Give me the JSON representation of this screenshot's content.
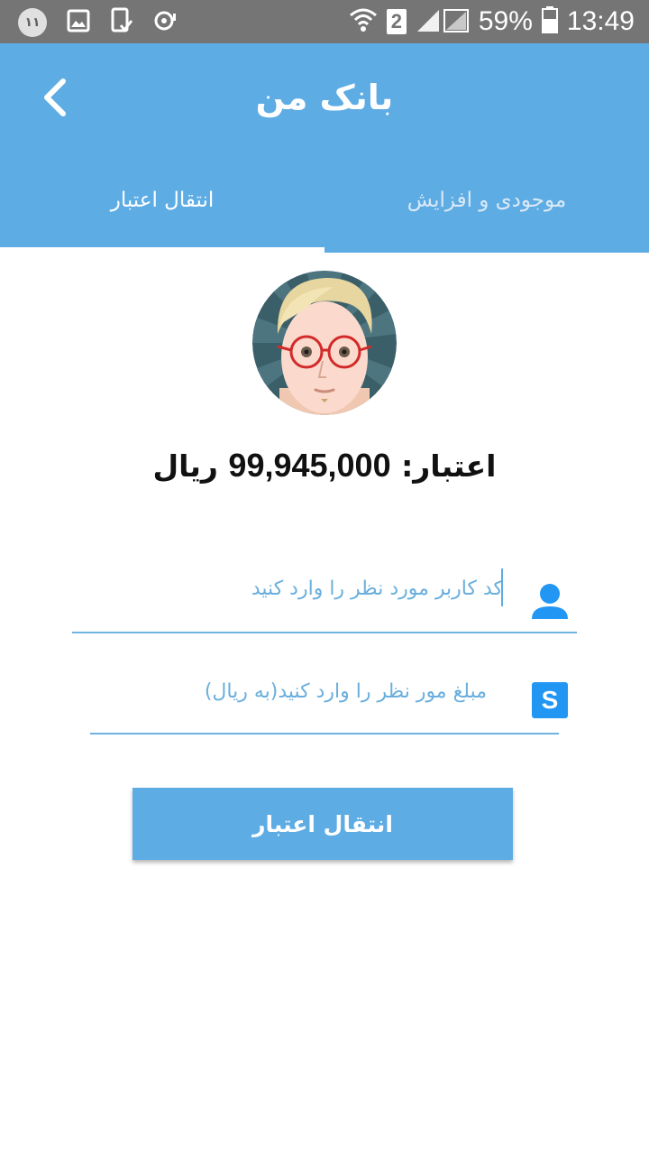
{
  "status_bar": {
    "notification_badge": "۱۱",
    "sim_label": "2",
    "battery": "59%",
    "time": "13:49"
  },
  "app_bar": {
    "title": "بانک من",
    "tabs": [
      {
        "label": "موجودی و افزایش",
        "active": false
      },
      {
        "label": "انتقال اعتبار",
        "active": true
      }
    ]
  },
  "balance": {
    "label": "اعتبار:",
    "amount": "99,945,000",
    "unit": "ریال"
  },
  "form": {
    "user_code_placeholder": "کد کاربر مورد نظر را وارد کنید",
    "amount_placeholder": "مبلغ مور نظر را وارد کنید(به ریال)",
    "amount_icon_letter": "S",
    "submit_label": "انتقال اعتبار"
  },
  "colors": {
    "primary": "#5DACE4",
    "status_bar": "#757575",
    "icon_blue": "#2196F3"
  }
}
